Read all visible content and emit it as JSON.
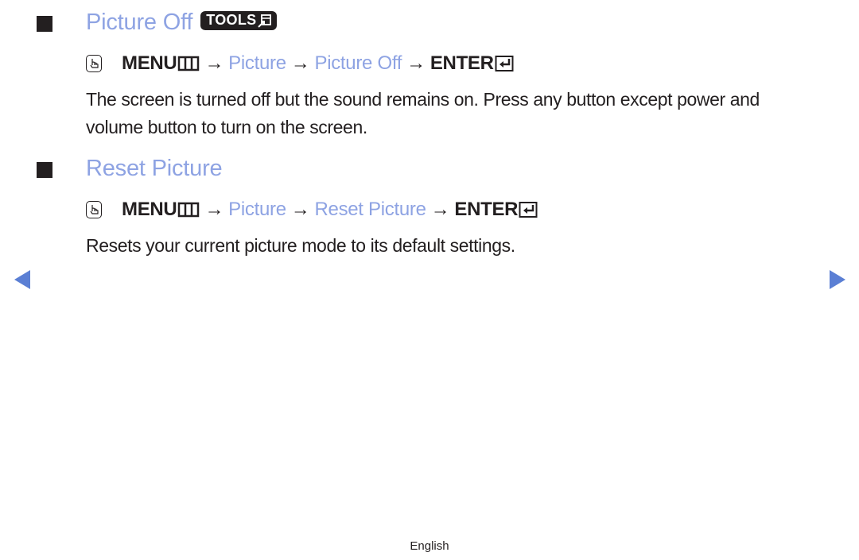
{
  "sections": [
    {
      "title": "Picture Off",
      "tools_badge": "TOOLS",
      "path": {
        "menu_label": "MENU",
        "arrow": "→",
        "items": [
          "Picture",
          "Picture Off"
        ],
        "enter_label": "ENTER"
      },
      "description": "The screen is turned off but the sound remains on. Press any button except power and volume button to turn on the screen."
    },
    {
      "title": "Reset Picture",
      "path": {
        "menu_label": "MENU",
        "arrow": "→",
        "items": [
          "Picture",
          "Reset Picture"
        ],
        "enter_label": "ENTER"
      },
      "description": "Resets your current picture mode to its default settings."
    }
  ],
  "navigation": {
    "prev_icon": "triangle-left-icon",
    "next_icon": "triangle-right-icon",
    "color": "#5b7fd4"
  },
  "footer": {
    "language": "English"
  },
  "colors": {
    "accent": "#8ea3e3",
    "text": "#231f20"
  }
}
